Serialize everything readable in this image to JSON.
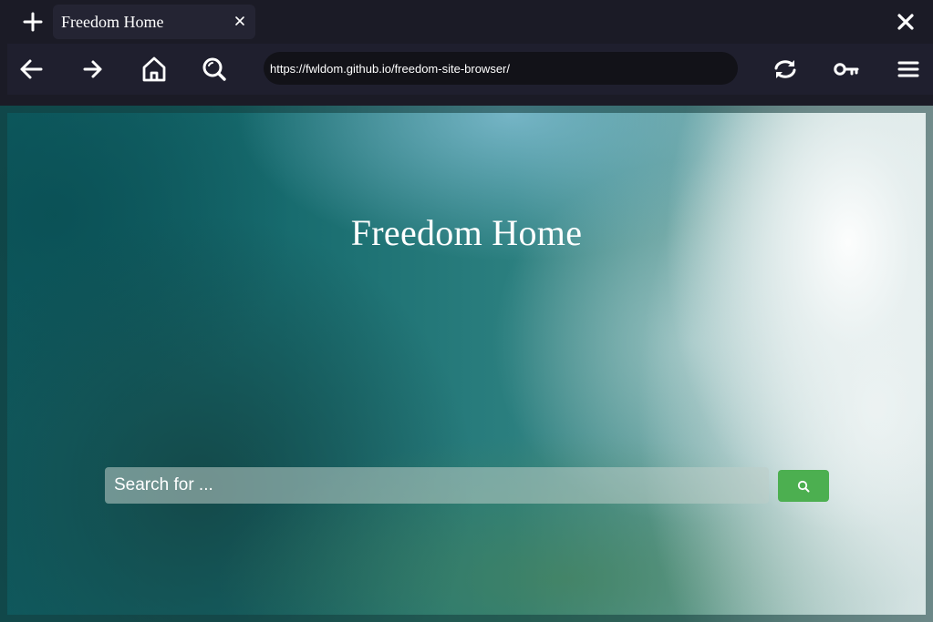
{
  "tab": {
    "title": "Freedom Home"
  },
  "navbar": {
    "url": "https://fwldom.github.io/freedom-site-browser/"
  },
  "page": {
    "title": "Freedom Home",
    "search_placeholder": "Search for ..."
  },
  "icons": {
    "new_tab": "plus-icon",
    "tab_close": "close-icon",
    "window_close": "close-icon",
    "back": "arrow-left-icon",
    "forward": "arrow-right-icon",
    "home": "home-icon",
    "search": "search-icon",
    "reload": "reload-icon",
    "key": "key-icon",
    "menu": "hamburger-menu-icon"
  },
  "colors": {
    "chrome_bg": "#1b1b26",
    "url_bar_bg": "#121218",
    "search_button": "#4caf50",
    "text": "#ffffff"
  }
}
